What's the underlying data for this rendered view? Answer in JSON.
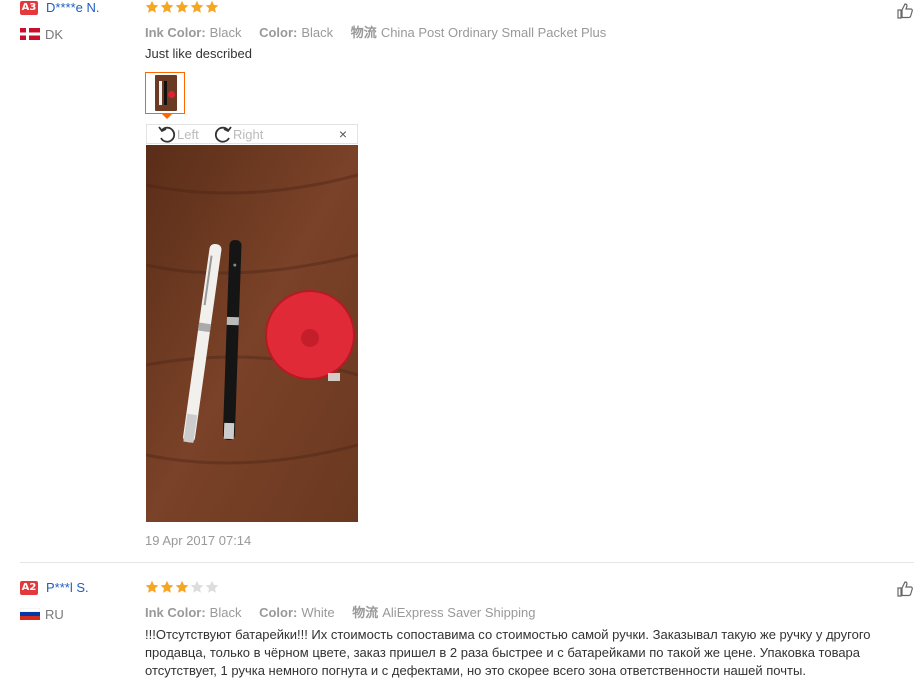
{
  "reviews": [
    {
      "badge": "A3",
      "badge_color": "#e4393c",
      "user": "D****e N.",
      "country": "DK",
      "rating": 5,
      "attrs": [
        {
          "key": "Ink Color:",
          "value": "Black"
        },
        {
          "key": "Color:",
          "value": "Black"
        },
        {
          "key": "物流",
          "value": "China Post Ordinary Small Packet Plus"
        }
      ],
      "text": "Just like described",
      "viewer": {
        "left": "Left",
        "right": "Right",
        "close": "×"
      },
      "date": "19 Apr 2017 07:14"
    },
    {
      "badge": "A2",
      "badge_color": "#e4393c",
      "user": "P***l S.",
      "country": "RU",
      "rating": 3,
      "attrs": [
        {
          "key": "Ink Color:",
          "value": "Black"
        },
        {
          "key": "Color:",
          "value": "White"
        },
        {
          "key": "物流",
          "value": "AliExpress Saver Shipping"
        }
      ],
      "text_lines": [
        "!!!Отсутствуют батарейки!!! Их стоимость сопоставима со стоимостью самой ручки. Заказывал такую же ручку у другого",
        "продавца, только в чёрном цвете, заказ пришел в 2 раза быстрее и с батарейками по такой же цене. Упаковка товара",
        "отсутствует, 1 ручка немного погнута и с дефектами, но это скорее всего зона ответственности нашей почты."
      ]
    }
  ],
  "colors": {
    "star_on": "#f5a623",
    "star_off": "#ddd",
    "username": "#1d5fc1",
    "accent": "#ff6600"
  }
}
